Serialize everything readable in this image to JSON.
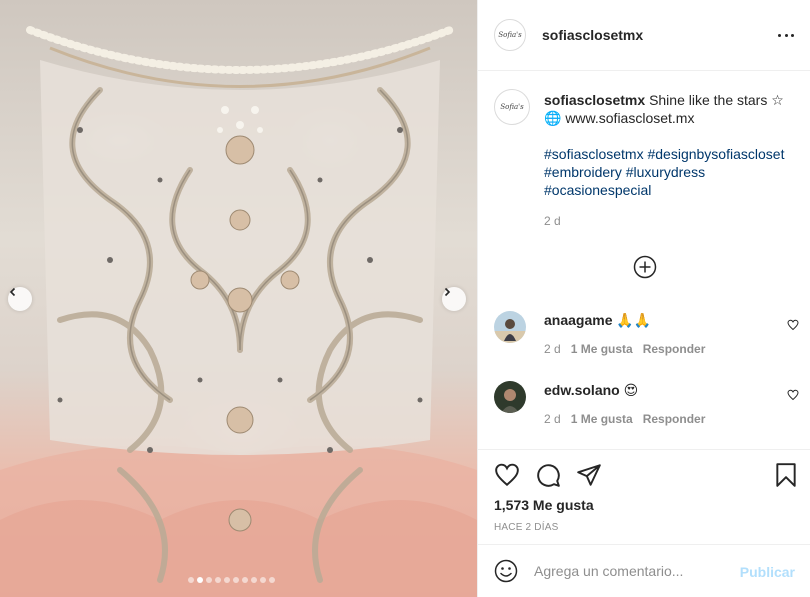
{
  "post": {
    "username": "sofiasclosetmx",
    "avatar_text": "Sofia's",
    "more_icon": "more-horizontal-icon"
  },
  "media": {
    "prev_icon": "chevron-left-icon",
    "next_icon": "chevron-right-icon",
    "slide_count": 10,
    "active_slide": 1
  },
  "caption": {
    "username": "sofiasclosetmx",
    "text": "Shine like the stars ☆",
    "link": "🌐 www.sofiascloset.mx",
    "hashtags": [
      "#sofiasclosetmx",
      "#designbysofiascloset",
      "#embroidery",
      "#luxurydress",
      "#ocasionespecial"
    ],
    "time": "2 d"
  },
  "comments": [
    {
      "username": "anaagame",
      "text": "🙏🙏",
      "time": "2 d",
      "likes": "1 Me gusta",
      "reply": "Responder"
    },
    {
      "username": "edw.solano",
      "text": "😍",
      "time": "2 d",
      "likes": "1 Me gusta",
      "reply": "Responder"
    }
  ],
  "actions": {
    "likes_count": "1,573 Me gusta",
    "posted_ago": "HACE 2 DÍAS"
  },
  "compose": {
    "placeholder": "Agrega un comentario...",
    "publish_label": "Publicar"
  },
  "colors": {
    "link": "#00376b",
    "muted": "#8e8e8e",
    "publish_disabled": "#b2dffc"
  }
}
